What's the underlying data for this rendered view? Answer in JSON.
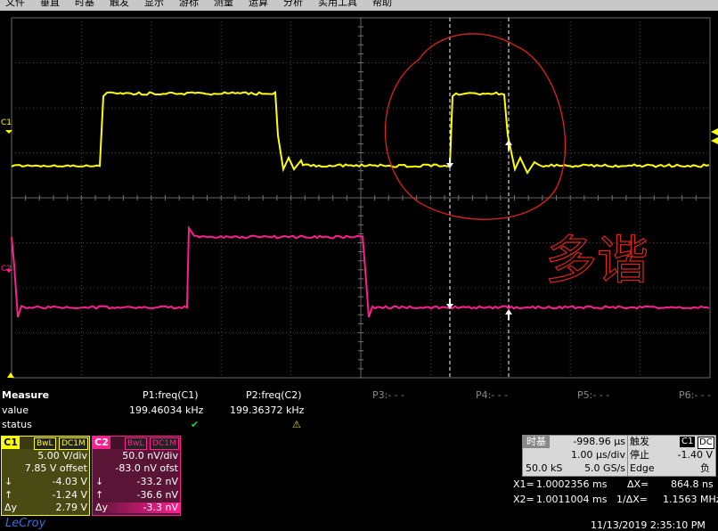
{
  "menu": [
    "文件",
    "垂直",
    "时基",
    "触发",
    "显示",
    "游标",
    "测量",
    "运算",
    "分析",
    "实用工具",
    "帮助"
  ],
  "traces": {
    "c1_label": "C1",
    "c2_label": "C2",
    "c1_color": "#ffff00",
    "c2_color": "#ff1f8f"
  },
  "annotation": {
    "text": "多谐",
    "color": "#e0241b"
  },
  "measure": {
    "title": "Measure",
    "row_value": "value",
    "row_status": "status",
    "params": [
      {
        "name": "P1:freq(C1)",
        "value": "199.46034 kHz",
        "status": "✔"
      },
      {
        "name": "P2:freq(C2)",
        "value": "199.36372 kHz",
        "status": "⚠"
      },
      {
        "name": "P3:- - -"
      },
      {
        "name": "P4:- - -"
      },
      {
        "name": "P5:- - -"
      },
      {
        "name": "P6:- - -"
      }
    ]
  },
  "ch1": {
    "tag": "C1",
    "bw": "BwL",
    "coupling": "DC1M",
    "vdiv": "5.00 V/div",
    "offset": "7.85 V offset",
    "cursor1": "-4.03 V",
    "cursor2": "-1.24 V",
    "delta": "2.79 V",
    "k1": "↓",
    "k2": "↑",
    "k3": "Δy"
  },
  "ch2": {
    "tag": "C2",
    "bw": "BwL",
    "coupling": "DC1M",
    "vdiv": "50.0 nV/div",
    "offset": "-83.0 nV ofst",
    "cursor1": "-33.2 nV",
    "cursor2": "-36.6 nV",
    "delta": "-3.3 nV",
    "k1": "↓",
    "k2": "↑",
    "k3": "Δy"
  },
  "timebase": {
    "label": "时基",
    "delay": "-998.96 μs",
    "tdiv": "1.00 μs/div",
    "samples": "50.0 kS",
    "rate": "5.0 GS/s"
  },
  "trigger": {
    "label": "触发",
    "source": "C1",
    "coupling": "DC",
    "mode": "停止",
    "level": "-1.40 V",
    "type": "Edge",
    "slope": "负"
  },
  "cursors": {
    "x1_label": "X1=",
    "x1": "1.0002356 ms",
    "dx_label": "ΔX=",
    "dx": "864.8 ns",
    "x2_label": "X2=",
    "x2": "1.0011004 ms",
    "inv_label": "1/ΔX=",
    "inv": "1.1563 MHz"
  },
  "datetime": "11/13/2019 2:35:10 PM",
  "logo": "LeCroy"
}
